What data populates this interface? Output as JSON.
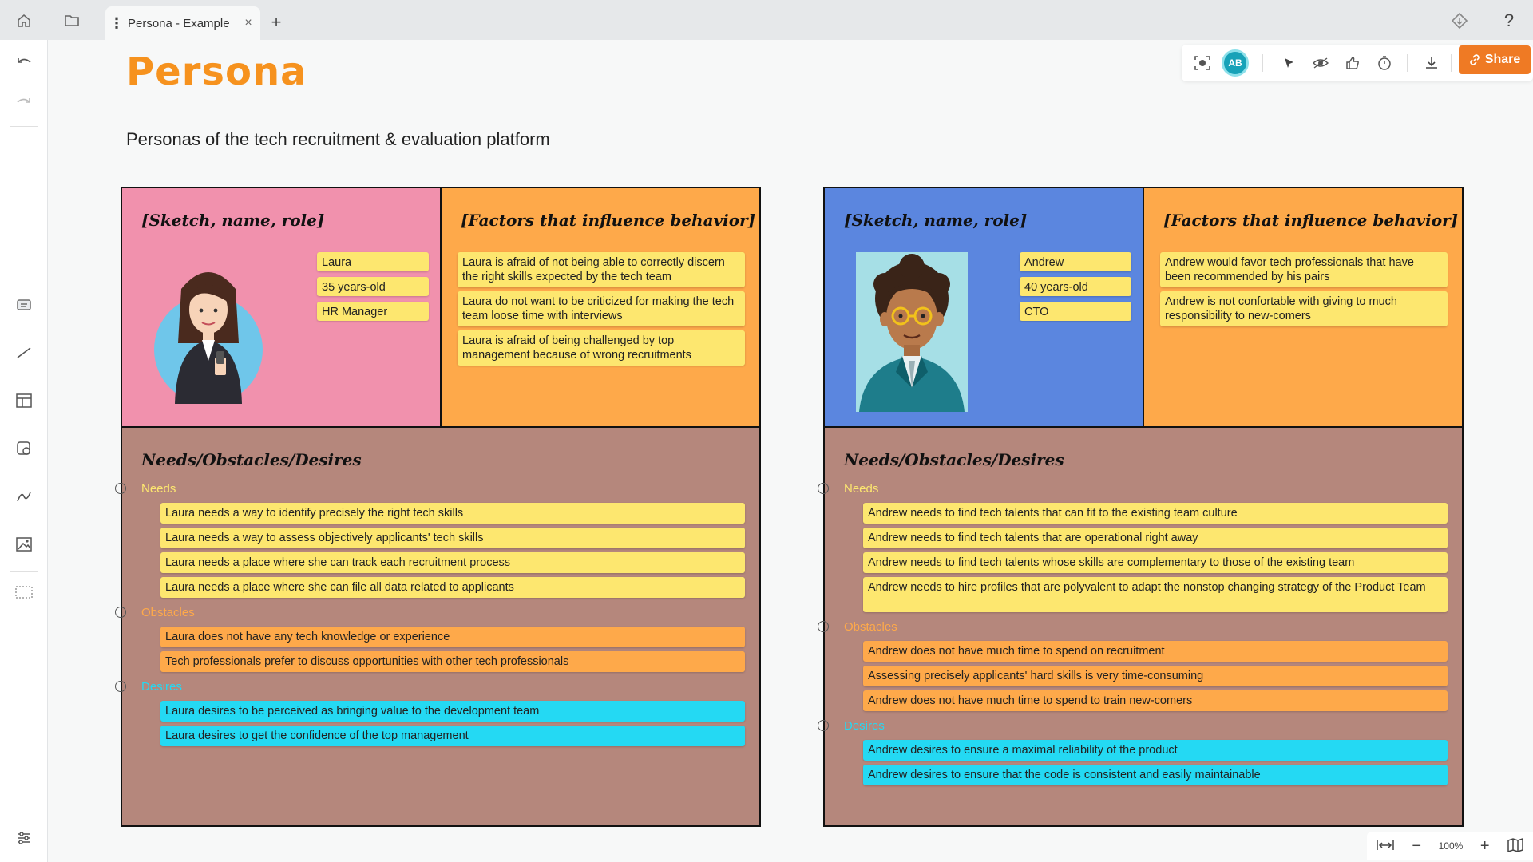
{
  "tab": {
    "title": "Persona - Example"
  },
  "board": {
    "title": "Persona",
    "subtitle": "Personas of the tech recruitment & evaluation platform"
  },
  "toolbar": {
    "avatar_initials": "AB",
    "share_label": "Share"
  },
  "zoom": {
    "level": "100%"
  },
  "colors": {
    "accent": "#ef7a24",
    "sticky_yellow": "#fde76f",
    "sticky_orange": "#fea94a",
    "sticky_cyan": "#24d9f3",
    "laura_bg": "#f191ad",
    "andrew_bg": "#5b86df",
    "needs_bg": "#b5877c"
  },
  "personas": [
    {
      "sketch_heading": "[Sketch, name, role]",
      "factors_heading": "[Factors that influence behavior]",
      "needs_heading": "Needs/Obstacles/Desires",
      "identity": [
        "Laura",
        "35 years-old",
        "HR Manager"
      ],
      "factors": [
        "Laura is afraid of not being able to correctly discern the right skills expected by the tech team",
        "Laura do not want to be criticized for making the tech team loose time with interviews",
        "Laura is afraid of being challenged by top management because of wrong recruitments"
      ],
      "needs_label": "Needs",
      "needs": [
        "Laura needs a way to identify precisely the right tech skills",
        "Laura needs a way to assess objectively applicants' tech skills",
        "Laura needs a place where she can track each recruitment process",
        "Laura needs a place where she can file all data related to applicants"
      ],
      "obstacles_label": "Obstacles",
      "obstacles": [
        "Laura does not have any tech knowledge or experience",
        "Tech professionals prefer to discuss opportunities with other tech professionals"
      ],
      "desires_label": "Desires",
      "desires": [
        "Laura desires to be perceived as bringing value to the development team",
        "Laura desires to get the confidence of the top management"
      ]
    },
    {
      "sketch_heading": "[Sketch, name, role]",
      "factors_heading": "[Factors that influence behavior]",
      "needs_heading": "Needs/Obstacles/Desires",
      "identity": [
        "Andrew",
        "40 years-old",
        "CTO"
      ],
      "factors": [
        "Andrew would favor tech professionals that have been recommended by his pairs",
        "Andrew is not confortable with giving to much responsibility to new-comers"
      ],
      "needs_label": "Needs",
      "needs": [
        "Andrew needs to find tech talents that can fit to the existing team culture",
        "Andrew needs to find tech talents that are operational right away",
        "Andrew needs to find tech talents whose skills are complementary to those of the existing team",
        "Andrew needs to hire profiles that are polyvalent to adapt the nonstop changing strategy of the Product Team"
      ],
      "obstacles_label": "Obstacles",
      "obstacles": [
        "Andrew does not have much time to spend on recruitment",
        "Assessing precisely applicants' hard skills is very time-consuming",
        "Andrew does not have much time to spend to train new-comers"
      ],
      "desires_label": "Desires",
      "desires": [
        "Andrew desires to ensure a maximal reliability of the product",
        "Andrew desires to ensure that the code is consistent and easily maintainable"
      ]
    }
  ]
}
